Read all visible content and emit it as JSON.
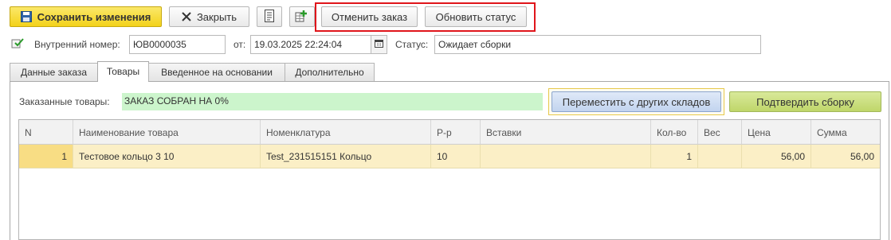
{
  "toolbar": {
    "save_label": "Сохранить изменения",
    "close_label": "Закрыть",
    "cancel_order_label": "Отменить заказ",
    "update_status_label": "Обновить статус"
  },
  "header": {
    "internal_number_label": "Внутренний номер:",
    "internal_number_value": "ЮВ0000035",
    "date_label": "от:",
    "date_value": "19.03.2025 22:24:04",
    "status_label": "Статус:",
    "status_value": "Ожидает сборки"
  },
  "tabs": [
    {
      "label": "Данные заказа"
    },
    {
      "label": "Товары"
    },
    {
      "label": "Введенное на основании"
    },
    {
      "label": "Дополнительно"
    }
  ],
  "goods": {
    "ordered_label": "Заказанные товары:",
    "ordered_status": "ЗАКАЗ СОБРАН НА 0%",
    "move_button": "Переместить с других складов",
    "confirm_button": "Подтвердить сборку"
  },
  "table": {
    "columns": [
      "N",
      "Наименование товара",
      "Номенклатура",
      "Р-р",
      "Вставки",
      "Кол-во",
      "Вес",
      "Цена",
      "Сумма"
    ],
    "rows": [
      {
        "n": "1",
        "name": "Тестовое кольцо 3 10",
        "nomenclature": "Test_231515151 Кольцо",
        "size": "10",
        "inserts": "",
        "qty": "1",
        "weight": "",
        "price": "56,00",
        "sum": "56,00"
      }
    ]
  },
  "colors": {
    "primary_button": "#f3d21a",
    "highlight_border": "#e0151b",
    "status_bar": "#ccf5cc",
    "selected_row": "#fbefc6"
  }
}
